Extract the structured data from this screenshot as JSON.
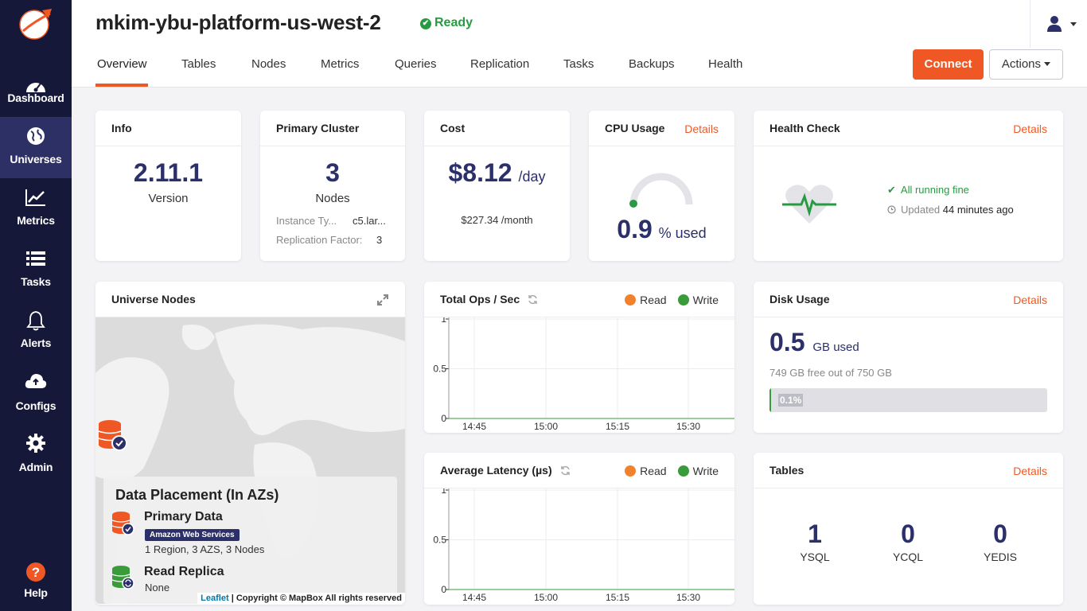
{
  "sidebar": {
    "items": [
      {
        "label": "Dashboard",
        "icon": "dashboard-icon"
      },
      {
        "label": "Universes",
        "icon": "globe-icon",
        "active": true
      },
      {
        "label": "Metrics",
        "icon": "chart-icon"
      },
      {
        "label": "Tasks",
        "icon": "list-icon"
      },
      {
        "label": "Alerts",
        "icon": "bell-icon"
      },
      {
        "label": "Configs",
        "icon": "cloud-icon"
      },
      {
        "label": "Admin",
        "icon": "gear-icon"
      },
      {
        "label": "Help",
        "icon": "help-icon"
      }
    ]
  },
  "header": {
    "title": "mkim-ybu-platform-us-west-2",
    "status": "Ready",
    "tabs": [
      "Overview",
      "Tables",
      "Nodes",
      "Metrics",
      "Queries",
      "Replication",
      "Tasks",
      "Backups",
      "Health"
    ],
    "active_tab": "Overview",
    "connect_label": "Connect",
    "actions_label": "Actions"
  },
  "info": {
    "title": "Info",
    "version": "2.11.1",
    "version_label": "Version"
  },
  "primary_cluster": {
    "title": "Primary Cluster",
    "nodes": "3",
    "nodes_label": "Nodes",
    "instance_type_label": "Instance Ty...",
    "instance_type_value": "c5.lar...",
    "replication_factor_label": "Replication Factor:",
    "replication_factor_value": "3"
  },
  "cost": {
    "title": "Cost",
    "daily": "$8.12",
    "daily_unit": "/day",
    "monthly": "$227.34 /month"
  },
  "cpu": {
    "title": "CPU Usage",
    "details": "Details",
    "value": "0.9",
    "unit": "% used",
    "percent": 0.9
  },
  "health": {
    "title": "Health Check",
    "details": "Details",
    "status": "All running fine",
    "updated_label": "Updated",
    "updated_value": "44 minutes ago"
  },
  "universe_nodes": {
    "title": "Universe Nodes",
    "placement_title": "Data Placement (In AZs)",
    "primary_title": "Primary Data",
    "provider_badge": "Amazon Web Services",
    "primary_summary": "1 Region, 3 AZS, 3 Nodes",
    "replica_title": "Read Replica",
    "replica_value": "None",
    "attribution_link": "Leaflet",
    "attribution_text": "| Copyright © MapBox All rights reserved"
  },
  "total_ops": {
    "title": "Total Ops / Sec",
    "legend_read": "Read",
    "legend_write": "Write"
  },
  "avg_latency": {
    "title": "Average Latency (µs)",
    "legend_read": "Read",
    "legend_write": "Write"
  },
  "disk": {
    "title": "Disk Usage",
    "details": "Details",
    "value": "0.5",
    "unit": "GB used",
    "free_text": "749 GB free out of 750 GB",
    "percent_label": "0.1%",
    "percent": 0.1
  },
  "tables": {
    "title": "Tables",
    "details": "Details",
    "ysql": "1",
    "ysql_label": "YSQL",
    "ycql": "0",
    "ycql_label": "YCQL",
    "yedis": "0",
    "yedis_label": "YEDIS"
  },
  "colors": {
    "accent": "#ef5824",
    "navy": "#2b2f6a",
    "sidebar": "#151838",
    "read": "#f0822e",
    "write": "#3a9b3a"
  },
  "chart_data": [
    {
      "type": "line",
      "title": "Total Ops / Sec",
      "x": [
        "14:45",
        "15:00",
        "15:15",
        "15:30"
      ],
      "ylim": [
        0,
        1
      ],
      "yticks": [
        "0",
        "0.5",
        "1"
      ],
      "series": [
        {
          "name": "Read",
          "values": [
            0,
            0,
            0,
            0
          ]
        },
        {
          "name": "Write",
          "values": [
            0,
            0,
            0,
            0
          ]
        }
      ],
      "legend": "top-right",
      "grid": true
    },
    {
      "type": "line",
      "title": "Average Latency (µs)",
      "x": [
        "14:45",
        "15:00",
        "15:15",
        "15:30"
      ],
      "ylim": [
        0,
        1
      ],
      "yticks": [
        "0",
        "0.5",
        "1"
      ],
      "series": [
        {
          "name": "Read",
          "values": [
            0,
            0,
            0,
            0
          ]
        },
        {
          "name": "Write",
          "values": [
            0,
            0,
            0,
            0
          ]
        }
      ],
      "legend": "top-right",
      "grid": true
    }
  ]
}
